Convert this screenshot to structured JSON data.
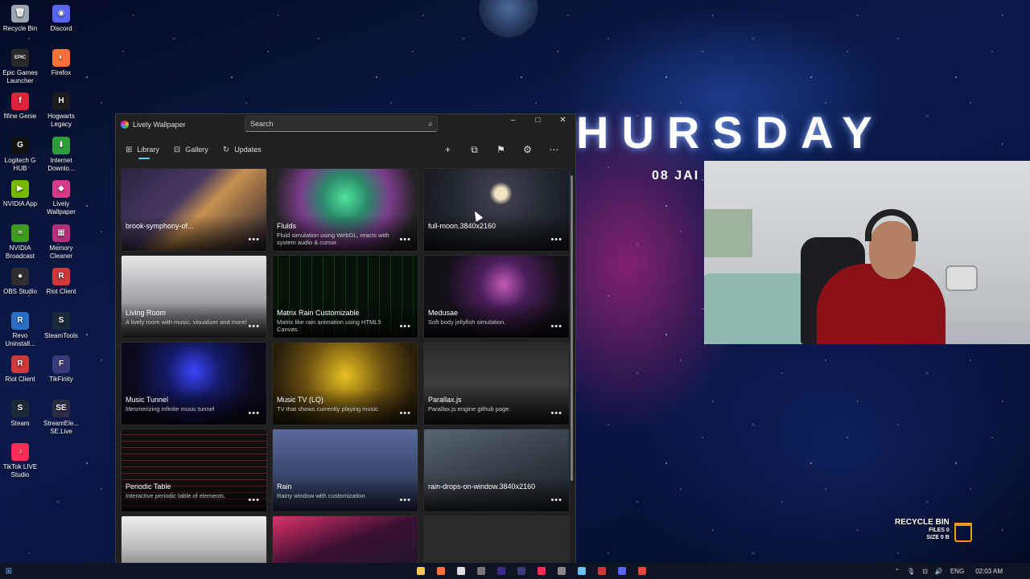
{
  "desktop_icons": [
    {
      "label": "Recycle Bin",
      "icon": "recycle-bin-icon",
      "glyph": "🗑",
      "color": "#9aa4b2"
    },
    {
      "label": "Discord",
      "icon": "discord-icon",
      "glyph": "◉",
      "color": "#5865f2"
    },
    {
      "label": "Epic Games Launcher",
      "icon": "epic-games-icon",
      "glyph": "EPIC",
      "color": "#2a2a2a"
    },
    {
      "label": "Firefox",
      "icon": "firefox-icon",
      "glyph": "◐",
      "color": "#ff7139"
    },
    {
      "label": "fifine Genie",
      "icon": "fifine-icon",
      "glyph": "f",
      "color": "#e0213a"
    },
    {
      "label": "Hogwarts Legacy",
      "icon": "hogwarts-icon",
      "glyph": "H",
      "color": "#1b1b1b"
    },
    {
      "label": "Logitech G HUB",
      "icon": "logitech-icon",
      "glyph": "G",
      "color": "#121212"
    },
    {
      "label": "Internet Downlo...",
      "icon": "idm-icon",
      "glyph": "⬇",
      "color": "#2e9e3c"
    },
    {
      "label": "NVIDIA App",
      "icon": "nvidia-icon",
      "glyph": "▶",
      "color": "#76b900"
    },
    {
      "label": "Lively Wallpaper",
      "icon": "lively-icon",
      "glyph": "◆",
      "color": "#d43b8a"
    },
    {
      "label": "NVIDIA Broadcast",
      "icon": "nvidia-broadcast-icon",
      "glyph": "≈",
      "color": "#3f9b1f"
    },
    {
      "label": "Memory Cleaner",
      "icon": "memory-cleaner-icon",
      "glyph": "▦",
      "color": "#b52e7a"
    },
    {
      "label": "OBS Studio",
      "icon": "obs-icon",
      "glyph": "●",
      "color": "#302e31"
    },
    {
      "label": "Riot Client",
      "icon": "riot-icon",
      "glyph": "R",
      "color": "#d13639"
    },
    {
      "label": "Revo Uninstall...",
      "icon": "revo-icon",
      "glyph": "R",
      "color": "#2b6fc4"
    },
    {
      "label": "SteamTools",
      "icon": "steamtools-icon",
      "glyph": "S",
      "color": "#1b2838"
    },
    {
      "label": "Riot Client",
      "icon": "riot-icon",
      "glyph": "R",
      "color": "#d13639"
    },
    {
      "label": "TikFinity",
      "icon": "tikfinity-icon",
      "glyph": "F",
      "color": "#3a3a7a"
    },
    {
      "label": "Steam",
      "icon": "steam-icon",
      "glyph": "S",
      "color": "#1b2838"
    },
    {
      "label": "StreamEle... SE.Live",
      "icon": "streamelements-icon",
      "glyph": "SE",
      "color": "#2b2b44"
    },
    {
      "label": "TikTok LIVE Studio",
      "icon": "tiktok-live-icon",
      "glyph": "♪",
      "color": "#fe2c55"
    }
  ],
  "clock_widget": {
    "day": "HURSDAY",
    "date": "08 JAI"
  },
  "recycle_widget": {
    "title": "RECYCLE BIN",
    "files": "FILES 0",
    "size": "SIZE 0 B"
  },
  "app": {
    "title": "Lively Wallpaper",
    "search_placeholder": "Search",
    "window_controls": {
      "minimize": "–",
      "maximize": "□",
      "close": "✕"
    },
    "tabs": [
      {
        "label": "Library",
        "icon": "grid-icon",
        "glyph": "⊞",
        "active": true
      },
      {
        "label": "Gallery",
        "icon": "bag-icon",
        "glyph": "⊟",
        "active": false
      },
      {
        "label": "Updates",
        "icon": "refresh-icon",
        "glyph": "↻",
        "active": false
      }
    ],
    "toolbar": [
      {
        "icon": "add-icon",
        "glyph": "+"
      },
      {
        "icon": "screen-icon",
        "glyph": "⧉"
      },
      {
        "icon": "flag-icon",
        "glyph": "⚑"
      },
      {
        "icon": "settings-icon",
        "glyph": "⚙"
      },
      {
        "icon": "more-icon",
        "glyph": "⋯"
      }
    ],
    "wallpapers": [
      {
        "title": "brook-symphony-of...",
        "desc": "",
        "bg": "linear-gradient(135deg,#2a2340,#4a3a60 40%,#c89050 55%,#1c1a2a)"
      },
      {
        "title": "Fluids",
        "desc": "Fluid simulation using WebGL, reacts with system audio & cursor.",
        "bg": "radial-gradient(circle at 50% 35%,#4fe39a,#2b8a6a 25%,#7a3c8a 50%,#222 80%)"
      },
      {
        "title": "full-moon.3840x2160",
        "desc": "",
        "bg": "radial-gradient(circle at 53% 30%,#f2e4c0 6%,#3a3e4a 12%,#222830 50%,#11141a)"
      },
      {
        "title": "Living Room",
        "desc": "A lively room with music, visualizer and more!",
        "bg": "linear-gradient(180deg,#e8e8ea,#9a9aa0 60%,#4a4a50)"
      },
      {
        "title": "Matrix Rain Customizable",
        "desc": "Matrix like rain animation using HTML5 Canvas.",
        "bg": "repeating-linear-gradient(90deg,#061208 0 6px,#0f3a18 6px 7px,#061208 7px 14px)"
      },
      {
        "title": "Medusae",
        "desc": "Soft body jellyfish simulation.",
        "bg": "radial-gradient(circle at 55% 35%,#c45ab8,#4a1e5a 25%,#141018 60%)"
      },
      {
        "title": "Music Tunnel",
        "desc": "Mesmerizing infinite music tunnel",
        "bg": "radial-gradient(circle at 50% 35%,#3a44ff,#141a66 30%,#0a0a1a 70%)"
      },
      {
        "title": "Music TV (LQ)",
        "desc": "TV that shows currently playing music",
        "bg": "radial-gradient(circle at 50% 40%,#e8c020,#6a5010 45%,#2a200a 80%)"
      },
      {
        "title": "Parallax.js",
        "desc": "Parallax.js engine github page.",
        "bg": "linear-gradient(180deg,#2a2a2a,#3c3c3c 50%,#1a1a1a)"
      },
      {
        "title": "Periodic Table",
        "desc": "Interactive periodic table of elements.",
        "bg": "repeating-linear-gradient(0deg,#101010 0 7px,#6a1c1c 7px 8px),linear-gradient(#223,#223)"
      },
      {
        "title": "Rain",
        "desc": "Rainy window with customization",
        "bg": "linear-gradient(180deg,#5a6a9a,#3a4a70 50%,#2a3450)"
      },
      {
        "title": "rain-drops-on-window.3840x2160",
        "desc": "",
        "bg": "linear-gradient(160deg,#5a6570,#2e363e 60%,#1c2228)"
      },
      {
        "title": "",
        "desc": "",
        "bg": "linear-gradient(180deg,#f0f0f0,#b8b8b8 40%,#303030)"
      },
      {
        "title": "",
        "desc": "",
        "bg": "linear-gradient(160deg,#e0306a,#3a1030 40%,#0e1a2a)"
      },
      {
        "title": "",
        "desc": "",
        "bg": "#2a2a2a"
      }
    ]
  },
  "taskbar": {
    "apps": [
      {
        "icon": "file-explorer-icon",
        "color": "#f7c948"
      },
      {
        "icon": "firefox-icon",
        "color": "#ff7139"
      },
      {
        "icon": "capcut-icon",
        "color": "#dddddd"
      },
      {
        "icon": "obs-icon",
        "color": "#777777"
      },
      {
        "icon": "premiere-icon",
        "color": "#3a2a8a"
      },
      {
        "icon": "tikfinity-icon",
        "color": "#3a3a7a"
      },
      {
        "icon": "tiktok-icon",
        "color": "#fe2c55"
      },
      {
        "icon": "calculator-icon",
        "color": "#888888"
      },
      {
        "icon": "steam-icon",
        "color": "#66c0f4"
      },
      {
        "icon": "riot-icon",
        "color": "#d13639"
      },
      {
        "icon": "discord-icon",
        "color": "#5865f2"
      },
      {
        "icon": "chrome-icon",
        "color": "#e8453c"
      }
    ],
    "tray": {
      "language": "ENG",
      "time": "02:03 AM"
    }
  }
}
